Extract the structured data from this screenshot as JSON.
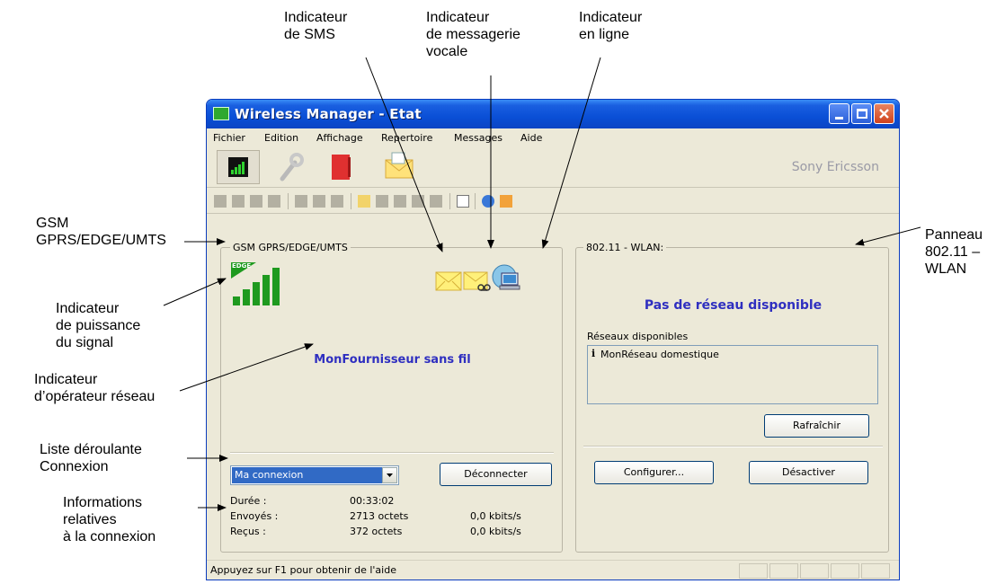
{
  "callouts": {
    "sms": "Indicateur\nde SMS",
    "voicemail": "Indicateur\nde messagerie\nvocale",
    "online": "Indicateur\nen ligne",
    "gsm": "GSM\nGPRS/EDGE/UMTS",
    "signal": "Indicateur\nde puissance\ndu signal",
    "operator": "Indicateur\nd’opérateur réseau",
    "connection_list": "Liste déroulante\nConnexion",
    "connection_info": "Informations\nrelatives\nà la connexion",
    "wlan_panel": "Panneau\n802.11 –\nWLAN"
  },
  "window": {
    "title": "Wireless Manager - Etat",
    "menu": [
      "Fichier",
      "Edition",
      "Affichage",
      "Repertoire",
      "Messages",
      "Aide"
    ],
    "brand": "Sony Ericsson",
    "status": "Appuyez sur F1 pour obtenir de l'aide"
  },
  "gsm": {
    "group_title": "GSM GPRS/EDGE/UMTS",
    "signal_badge": "EDGE",
    "signal_level": 1.0,
    "operator": "MonFournisseur sans fil",
    "connection_selected": "Ma connexion",
    "disconnect_label": "Déconnecter",
    "stats": {
      "duration_label": "Durée :",
      "duration": "00:33:02",
      "sent_label": "Envoyés :",
      "sent": "2713 octets",
      "sent_rate": "0,0 kbits/s",
      "received_label": "Reçus :",
      "received": "372 octets",
      "received_rate": "0,0 kbits/s"
    }
  },
  "wlan": {
    "group_title": "802.11 - WLAN:",
    "headline": "Pas de réseau disponible",
    "networks_label": "Réseaux disponibles",
    "networks": [
      "MonRéseau domestique"
    ],
    "refresh_label": "Rafraîchir",
    "configure_label": "Configurer...",
    "disable_label": "Désactiver"
  },
  "colors": {
    "titlebar": "#0a4fd6",
    "headline": "#2f2fc0",
    "signal_green": "#1f9a1f",
    "selection": "#316ac5"
  }
}
